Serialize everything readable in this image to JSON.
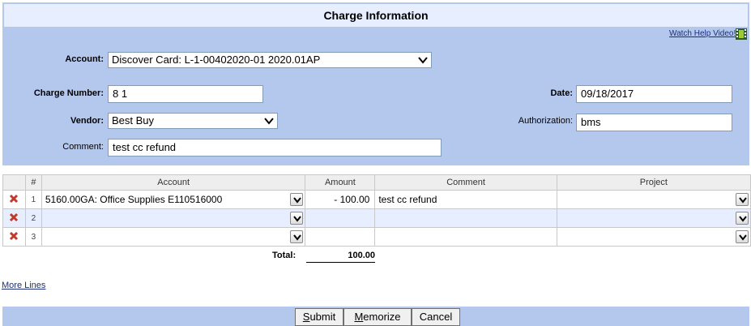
{
  "header": {
    "title": "Charge Information",
    "help_link": "Watch Help Video!"
  },
  "form": {
    "account_label": "Account:",
    "account_value": "Discover Card: L-1-00402020-01 2020.01AP",
    "charge_number_label": "Charge Number:",
    "charge_number_value": "8 1",
    "date_label": "Date:",
    "date_value": "09/18/2017",
    "vendor_label": "Vendor:",
    "vendor_value": "Best Buy",
    "authorization_label": "Authorization:",
    "authorization_value": "bms",
    "comment_label": "Comment:",
    "comment_value": "test cc refund"
  },
  "grid": {
    "columns": [
      "#",
      "Account",
      "Amount",
      "Comment",
      "Project"
    ],
    "rows": [
      {
        "num": "1",
        "account": "5160.00GA: Office Supplies E110516000",
        "amount": "- 100.00",
        "comment": "test cc refund",
        "project": ""
      },
      {
        "num": "2",
        "account": "",
        "amount": "",
        "comment": "",
        "project": ""
      },
      {
        "num": "3",
        "account": "",
        "amount": "",
        "comment": "",
        "project": ""
      }
    ],
    "total_label": "Total:",
    "total_value": "100.00"
  },
  "links": {
    "more_lines": "More Lines"
  },
  "buttons": {
    "submit_prefix": "S",
    "submit_rest": "ubmit",
    "memorize_prefix": "M",
    "memorize_rest": "emorize",
    "cancel": "Cancel"
  },
  "colors": {
    "panel": "#b4c8ee",
    "title_bar": "#e6eeff",
    "delete_x": "#c0392b"
  }
}
